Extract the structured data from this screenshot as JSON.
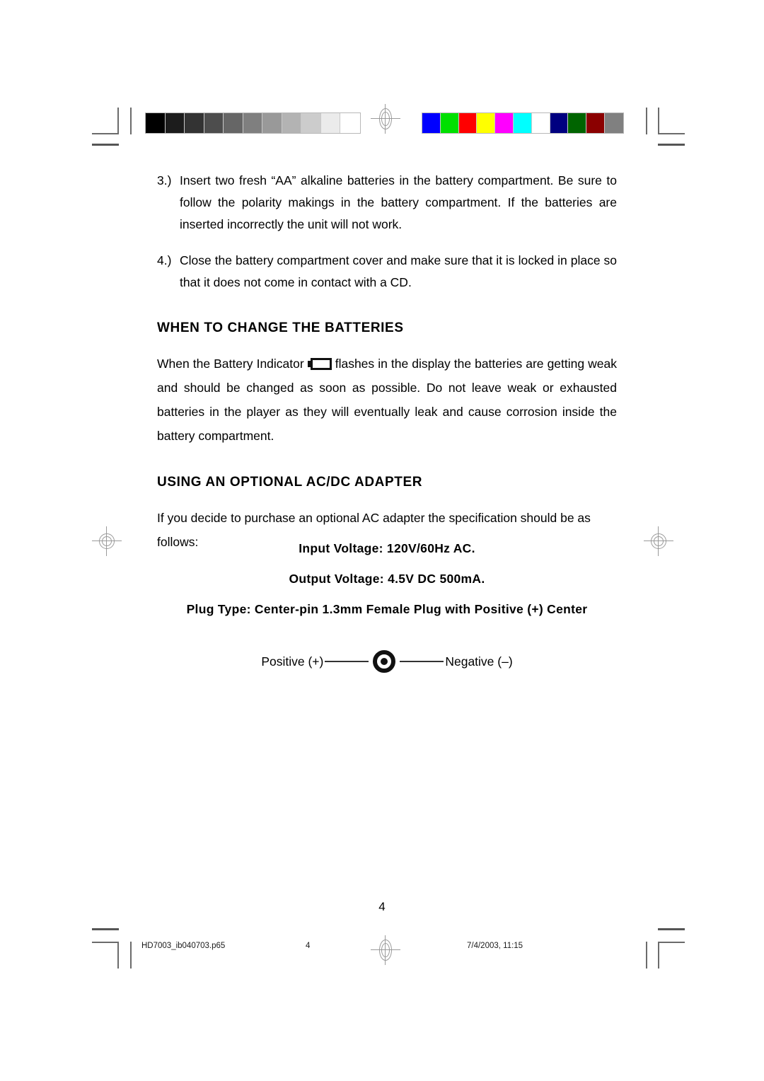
{
  "document": {
    "page_number_display": "4"
  },
  "calibration": {
    "grayscale_bar": {
      "name": "grayscale-calibration-bar",
      "swatches": [
        "#000000",
        "#1c1c1c",
        "#333333",
        "#4d4d4d",
        "#666666",
        "#7f7f7f",
        "#999999",
        "#b3b3b3",
        "#cccccc",
        "#ebebeb",
        "#ffffff"
      ]
    },
    "color_bar": {
      "name": "color-calibration-bar",
      "swatches": [
        "#0000ff",
        "#00e000",
        "#ff0000",
        "#ffff00",
        "#ff00ff",
        "#00ffff",
        "#ffffff",
        "#000080",
        "#006400",
        "#8b0000",
        "#808080"
      ]
    }
  },
  "instructions": [
    {
      "number": "3.)",
      "text": "Insert two fresh “AA” alkaline batteries in the battery compartment. Be sure to follow the polarity makings in the battery compartment. If the batteries are inserted incorrectly the unit will not work."
    },
    {
      "number": "4.)",
      "text": "Close the battery compartment cover and make sure that it is locked in place so that it does not come in contact with a CD."
    }
  ],
  "batteries_section": {
    "heading": "WHEN TO CHANGE THE BATTERIES",
    "text_before_icon": "When the Battery Indicator",
    "icon_name": "battery-indicator-icon",
    "text_after_icon": "flashes in the display the batteries are getting weak and should be changed as soon as possible. Do not leave weak or exhausted batteries in the player as they will eventually leak and cause corrosion inside the battery compartment."
  },
  "adapter_section": {
    "heading": "USING AN OPTIONAL AC/DC ADAPTER",
    "intro": "If you decide to purchase an optional AC adapter the specification should be as follows:",
    "specs": [
      "Input Voltage: 120V/60Hz AC.",
      "Output Voltage: 4.5V DC 500mA.",
      "Plug Type: Center-pin 1.3mm Female Plug with Positive (+) Center"
    ],
    "polarity_diagram": {
      "left_label": "Positive (+)",
      "right_label": "Negative (–)",
      "symbol_name": "coaxial-plug-polarity-icon"
    }
  },
  "footer": {
    "filename": "HD7003_ib040703.p65",
    "page": "4",
    "datetime": "7/4/2003, 11:15"
  }
}
